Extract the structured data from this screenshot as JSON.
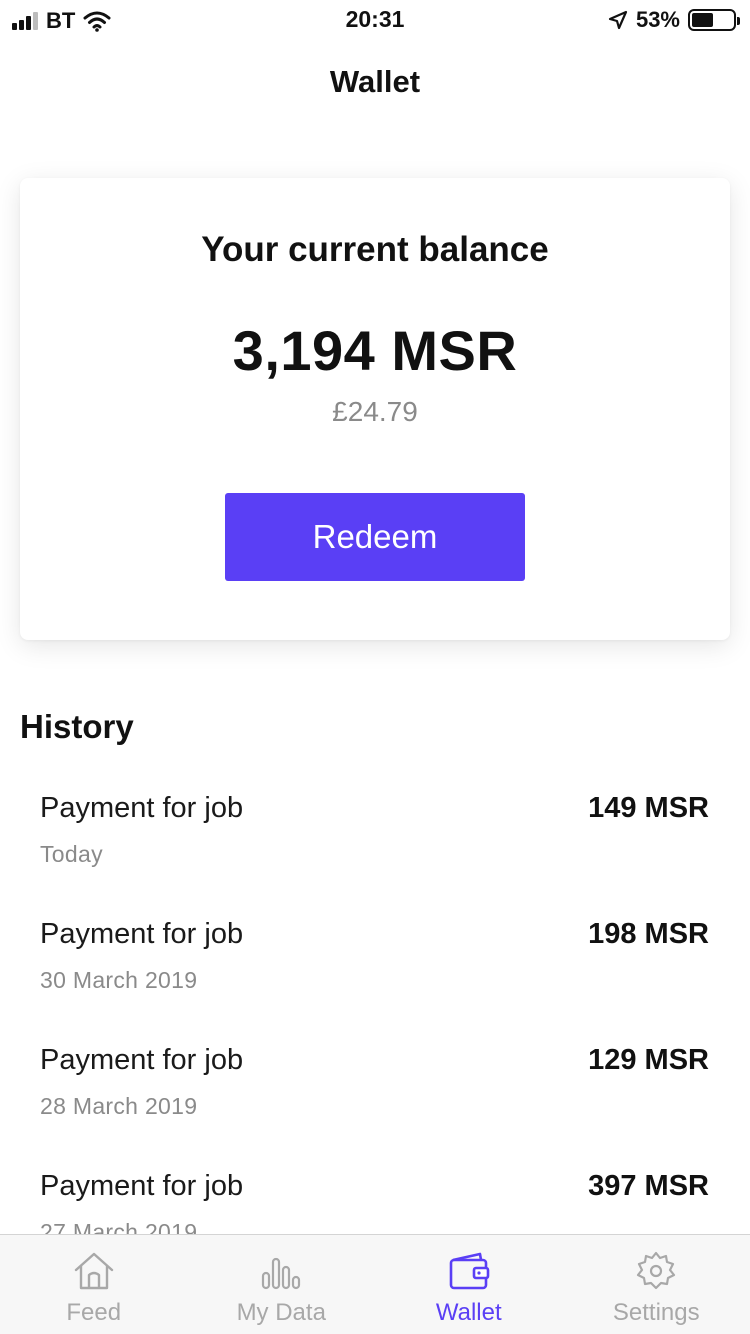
{
  "status_bar": {
    "carrier": "BT",
    "time": "20:31",
    "battery_percent_label": "53%",
    "battery_level": 0.53
  },
  "header": {
    "title": "Wallet"
  },
  "balance": {
    "heading": "Your current balance",
    "amount": "3,194 MSR",
    "fiat": "£24.79",
    "redeem_label": "Redeem"
  },
  "history": {
    "title": "History",
    "items": [
      {
        "title": "Payment for job",
        "date": "Today",
        "amount": "149 MSR"
      },
      {
        "title": "Payment for job",
        "date": "30 March 2019",
        "amount": "198 MSR"
      },
      {
        "title": "Payment for job",
        "date": "28 March 2019",
        "amount": "129 MSR"
      },
      {
        "title": "Payment for job",
        "date": "27 March 2019",
        "amount": "397 MSR"
      }
    ]
  },
  "tabs": [
    {
      "label": "Feed",
      "icon": "home-icon"
    },
    {
      "label": "My Data",
      "icon": "bar-chart-icon"
    },
    {
      "label": "Wallet",
      "icon": "wallet-icon",
      "active": true
    },
    {
      "label": "Settings",
      "icon": "gear-icon"
    }
  ],
  "colors": {
    "accent": "#5a3ff5",
    "inactive_tab": "#a8a8a8",
    "secondary_text": "#8a8a8a"
  }
}
